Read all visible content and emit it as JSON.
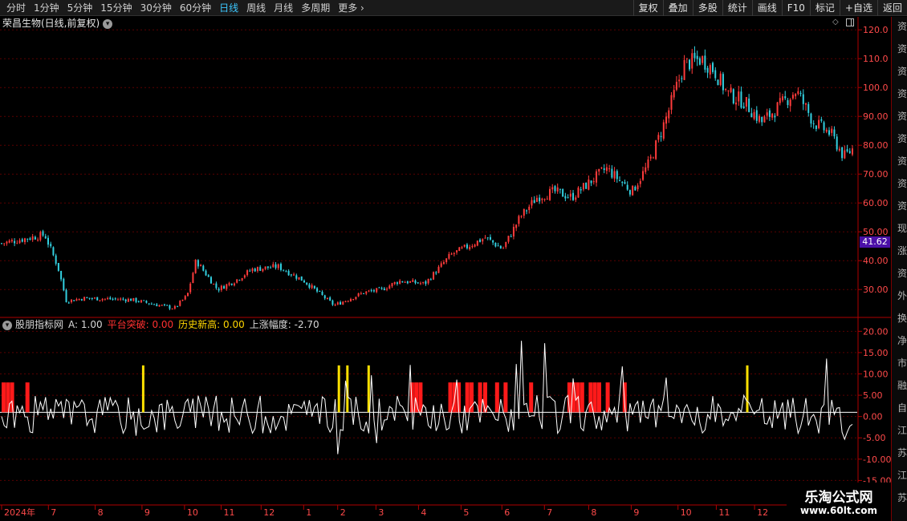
{
  "toolbar": {
    "periods": [
      "分时",
      "1分钟",
      "5分钟",
      "15分钟",
      "30分钟",
      "60分钟",
      "日线",
      "周线",
      "月线",
      "多周期",
      "更多"
    ],
    "active_period": "日线",
    "tools": [
      "复权",
      "叠加",
      "多股",
      "统计",
      "画线",
      "F10",
      "标记",
      "+自选",
      "返回"
    ]
  },
  "chart": {
    "title": "荣昌生物(日线,前复权)",
    "current_price": "41.62",
    "price_axis": [
      "120.0",
      "110.0",
      "100.0",
      "90.00",
      "80.00",
      "70.00",
      "60.00",
      "50.00",
      "40.00",
      "30.00"
    ],
    "colors": {
      "up": "#ff3b3b",
      "down": "#33d0e0",
      "grid": "#5a0000",
      "axis": "#b00000"
    }
  },
  "indicator": {
    "name": "股朋指标网",
    "a_label": "A: 1.00",
    "platform_label": "平台突破: 0.00",
    "history_label": "历史新高: 0.00",
    "rise_label": "上涨幅度: -2.70",
    "axis": [
      "20.00",
      "15.00",
      "10.00",
      "5.00",
      "0.00",
      "-5.00",
      "-10.00",
      "-15.00"
    ]
  },
  "time_axis": [
    "2024年",
    "7",
    "8",
    "9",
    "10",
    "11",
    "12",
    "1",
    "2",
    "3",
    "4",
    "5",
    "6",
    "7",
    "8",
    "9",
    "10",
    "11",
    "12"
  ],
  "side_panel": [
    "资",
    "资",
    "资",
    "资",
    "资",
    "资",
    "资",
    "资",
    "资",
    "现",
    "涨",
    "资",
    "外",
    "换",
    "净",
    "市",
    "融",
    "自",
    "江",
    "苏",
    "江",
    "苏"
  ],
  "watermark": {
    "title": "乐淘公式网",
    "url": "www.60lt.com"
  },
  "chart_data": {
    "type": "candlestick",
    "y_range": [
      22,
      122
    ],
    "price_path": [
      [
        0,
        46
      ],
      [
        0.05,
        49
      ],
      [
        0.065,
        38
      ],
      [
        0.075,
        26
      ],
      [
        0.095,
        27
      ],
      [
        0.15,
        26.5
      ],
      [
        0.2,
        23.5
      ],
      [
        0.215,
        28
      ],
      [
        0.225,
        40
      ],
      [
        0.25,
        30
      ],
      [
        0.27,
        33
      ],
      [
        0.29,
        37
      ],
      [
        0.32,
        38
      ],
      [
        0.35,
        33
      ],
      [
        0.385,
        24.5
      ],
      [
        0.42,
        29
      ],
      [
        0.44,
        30
      ],
      [
        0.46,
        33
      ],
      [
        0.49,
        32
      ],
      [
        0.52,
        42
      ],
      [
        0.54,
        45
      ],
      [
        0.56,
        48
      ],
      [
        0.58,
        44
      ],
      [
        0.6,
        55
      ],
      [
        0.62,
        62
      ],
      [
        0.64,
        64
      ],
      [
        0.66,
        62
      ],
      [
        0.7,
        72
      ],
      [
        0.73,
        64
      ],
      [
        0.75,
        74
      ],
      [
        0.77,
        90
      ],
      [
        0.79,
        108
      ],
      [
        0.81,
        110
      ],
      [
        0.825,
        106
      ],
      [
        0.84,
        98
      ],
      [
        0.86,
        95
      ],
      [
        0.88,
        88
      ],
      [
        0.92,
        99
      ],
      [
        0.94,
        88
      ],
      [
        0.96,
        84
      ],
      [
        0.975,
        76
      ],
      [
        0.99,
        80
      ],
      [
        1.0,
        88
      ],
      [
        1.02,
        111
      ],
      [
        1.05,
        101
      ],
      [
        1.08,
        104
      ]
    ],
    "indicator_range": [
      -20,
      21
    ],
    "red_bars": [
      0.0,
      0.005,
      0.01,
      0.028,
      0.48,
      0.485,
      0.49,
      0.525,
      0.53,
      0.535,
      0.545,
      0.55,
      0.56,
      0.566,
      0.58,
      0.59,
      0.62,
      0.665,
      0.67,
      0.675,
      0.68,
      0.69,
      0.695,
      0.7,
      0.71,
      0.73
    ],
    "yellow_bars": [
      0.165,
      0.395,
      0.405,
      0.43,
      0.875
    ]
  }
}
